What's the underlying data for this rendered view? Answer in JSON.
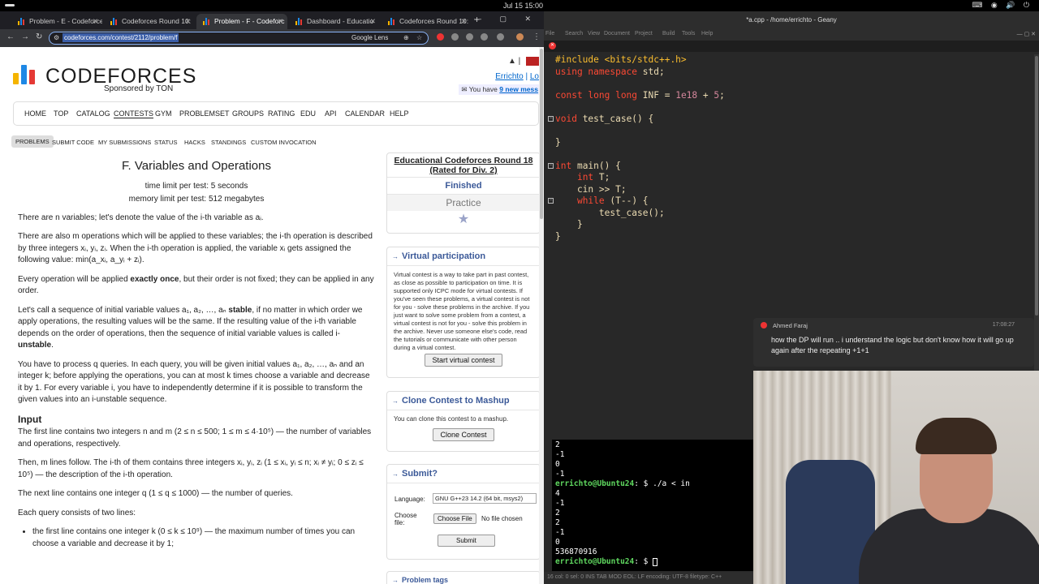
{
  "system": {
    "clock": "Jul 15  15:00",
    "tray": "⌨ ◉ 🔊 ⏻"
  },
  "browser": {
    "tabs": [
      {
        "label": "Problem - E - Codeforce"
      },
      {
        "label": "Codeforces Round 10:"
      },
      {
        "label": "Problem - F - Codeforc"
      },
      {
        "label": "Dashboard - Educatio"
      },
      {
        "label": "Codeforces Round 10:"
      }
    ],
    "url": "codeforces.com/contest/2112/problem/f",
    "lens_label": "Google Lens"
  },
  "site": {
    "logo_text": "CODEFORCES",
    "sponsored": "Sponsored by TON",
    "user": "Errichto",
    "logout": "Lo",
    "messages_prefix": "You have",
    "messages_link": "9 new mess",
    "menu": [
      "HOME",
      "TOP",
      "CATALOG",
      "CONTESTS",
      "GYM",
      "PROBLEMSET",
      "GROUPS",
      "RATING",
      "EDU",
      "API",
      "CALENDAR",
      "HELP"
    ],
    "submenu": [
      "PROBLEMS",
      "SUBMIT CODE",
      "MY SUBMISSIONS",
      "STATUS",
      "HACKS",
      "STANDINGS",
      "CUSTOM INVOCATION"
    ]
  },
  "problem": {
    "title": "F. Variables and Operations",
    "time_limit": "time limit per test: 5 seconds",
    "memory_limit": "memory limit per test: 512 megabytes",
    "p1": "There are n variables; let's denote the value of the i-th variable as aᵢ.",
    "p2": "There are also m operations which will be applied to these variables; the i-th operation is described by three integers xᵢ, yᵢ, zᵢ. When the i-th operation is applied, the variable xᵢ gets assigned the following value: min(a_xᵢ, a_yᵢ + zᵢ).",
    "p3a": "Every operation will be applied ",
    "p3b": "exactly once",
    "p3c": ", but their order is not fixed; they can be applied in any order.",
    "p4a": "Let's call a sequence of initial variable values a₁, a₂, …, aₙ ",
    "p4b": "stable",
    "p4c": ", if no matter in which order we apply operations, the resulting values will be the same. If the resulting value of the i-th variable depends on the order of operations, then the sequence of initial variable values is called i-",
    "p4d": "unstable",
    "p4e": ".",
    "p5": "You have to process q queries. In each query, you will be given initial values a₁, a₂, …, aₙ and an integer k; before applying the operations, you can at most k times choose a variable and decrease it by 1. For every variable i, you have to independently determine if it is possible to transform the given values into an i-unstable sequence.",
    "input_title": "Input",
    "in1": "The first line contains two integers n and m (2 ≤ n ≤ 500; 1 ≤ m ≤ 4·10⁵) — the number of variables and operations, respectively.",
    "in2": "Then, m lines follow. The i-th of them contains three integers xᵢ, yᵢ, zᵢ (1 ≤ xᵢ, yᵢ ≤ n; xᵢ ≠ yᵢ; 0 ≤ zᵢ ≤ 10⁵) — the description of the i-th operation.",
    "in3": "The next line contains one integer q (1 ≤ q ≤ 1000) — the number of queries.",
    "in4": "Each query consists of two lines:",
    "in5": "the first line contains one integer k (0 ≤ k ≤ 10⁹) — the maximum number of times you can choose a variable and decrease it by 1;"
  },
  "sidebar": {
    "contest_name": "Educational Codeforces Round 18",
    "rated": "(Rated for Div. 2)",
    "status": "Finished",
    "practice": "Practice",
    "virtual_title": "Virtual participation",
    "virtual_text": "Virtual contest is a way to take part in past contest, as close as possible to participation on time. It is supported only ICPC mode for virtual contests. If you've seen these problems, a virtual contest is not for you - solve these problems in the archive. If you just want to solve some problem from a contest, a virtual contest is not for you - solve this problem in the archive. Never use someone else's code, read the tutorials or communicate with other person during a virtual contest.",
    "virtual_button": "Start virtual contest",
    "clone_title": "Clone Contest to Mashup",
    "clone_text": "You can clone this contest to a mashup.",
    "clone_button": "Clone Contest",
    "submit_title": "Submit?",
    "language_label": "Language:",
    "language_value": "GNU G++23 14.2 (64 bit, msys2)",
    "file_label": "Choose file:",
    "choose_file": "Choose File",
    "no_file": "No file chosen",
    "submit_button": "Submit",
    "next_title": "Problem tags"
  },
  "editor": {
    "title": "*a.cpp - /home/errichto - Geany",
    "menu": [
      "File",
      "Edit",
      "Search",
      "View",
      "Document",
      "Project",
      "Build",
      "Tools",
      "Help"
    ],
    "status": "16  col: 0  sel: 0   INS   TAB   MOD   EOL: LF    encoding: UTF-8    filetype: C++"
  },
  "notification": {
    "author": "Ahmed Faraj",
    "time": "17:08:27",
    "message": "how the DP will run .. i understand the logic but don't know how it will go up again after the repeating +1+1"
  },
  "terminal": {
    "lines_before": [
      "2",
      "-1",
      "0",
      "-1"
    ],
    "prompt": "errichto@Ubuntu24",
    "cmd": ": $ ./a < in",
    "lines_after": [
      "4",
      "-1",
      "2",
      "2",
      "-1",
      "0",
      "536870916"
    ],
    "prompt2_suffix": ": $ "
  },
  "colors": {
    "cf_blue": "#3b5998",
    "prompt_green": "#5fd75f",
    "code_bg": "#282828"
  }
}
